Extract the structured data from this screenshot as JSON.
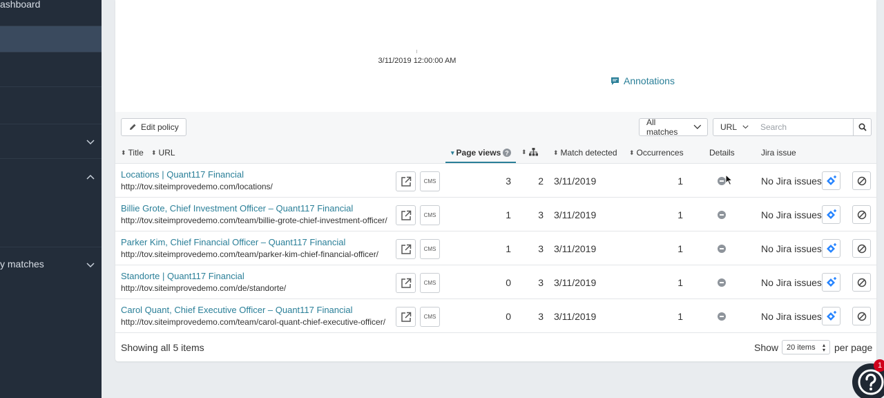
{
  "sidebar": {
    "items": [
      {
        "label": "ashboard",
        "chevron": ""
      },
      {
        "label": "",
        "chevron": ""
      },
      {
        "label": "",
        "chevron": ""
      },
      {
        "label": "",
        "chevron": "down"
      },
      {
        "label": "",
        "chevron": "up"
      },
      {
        "label": "y matches",
        "chevron": "down"
      }
    ]
  },
  "chart": {
    "x_tick_label": "3/11/2019 12:00:00 AM",
    "annotations_label": "Annotations"
  },
  "toolbar": {
    "edit_policy_label": "Edit policy",
    "match_filter": "All matches",
    "field_filter": "URL",
    "search_placeholder": "Search"
  },
  "table": {
    "headers": {
      "title": "Title",
      "url": "URL",
      "page_views": "Page views",
      "match_detected": "Match detected",
      "occurrences": "Occurrences",
      "details": "Details",
      "jira_issue": "Jira issue"
    },
    "cms_label": "CMS",
    "rows": [
      {
        "title": "Locations | Quant117 Financial",
        "url": "http://tov.siteimprovedemo.com/locations/",
        "page_views": "3",
        "level": "2",
        "match_detected": "3/11/2019",
        "occurrences": "1",
        "jira": "No Jira issues"
      },
      {
        "title": "Billie Grote, Chief Investment Officer – Quant117 Financial",
        "url": "http://tov.siteimprovedemo.com/team/billie-grote-chief-investment-officer/",
        "page_views": "1",
        "level": "3",
        "match_detected": "3/11/2019",
        "occurrences": "1",
        "jira": "No Jira issues"
      },
      {
        "title": "Parker Kim, Chief Financial Officer – Quant117 Financial",
        "url": "http://tov.siteimprovedemo.com/team/parker-kim-chief-financial-officer/",
        "page_views": "1",
        "level": "3",
        "match_detected": "3/11/2019",
        "occurrences": "1",
        "jira": "No Jira issues"
      },
      {
        "title": "Standorte | Quant117 Financial",
        "url": "http://tov.siteimprovedemo.com/de/standorte/",
        "page_views": "0",
        "level": "3",
        "match_detected": "3/11/2019",
        "occurrences": "1",
        "jira": "No Jira issues"
      },
      {
        "title": "Carol Quant, Chief Executive Officer – Quant117 Financial",
        "url": "http://tov.siteimprovedemo.com/team/carol-quant-chief-executive-officer/",
        "page_views": "0",
        "level": "3",
        "match_detected": "3/11/2019",
        "occurrences": "1",
        "jira": "No Jira issues"
      }
    ]
  },
  "footer": {
    "showing": "Showing all 5 items",
    "show_label": "Show",
    "per_page_value": "20 items",
    "per_page_label": "per page"
  },
  "help": {
    "badge": "1"
  },
  "colors": {
    "accent": "#2a7f98",
    "sidebar": "#232d3a",
    "jira_blue": "#2684ff"
  }
}
